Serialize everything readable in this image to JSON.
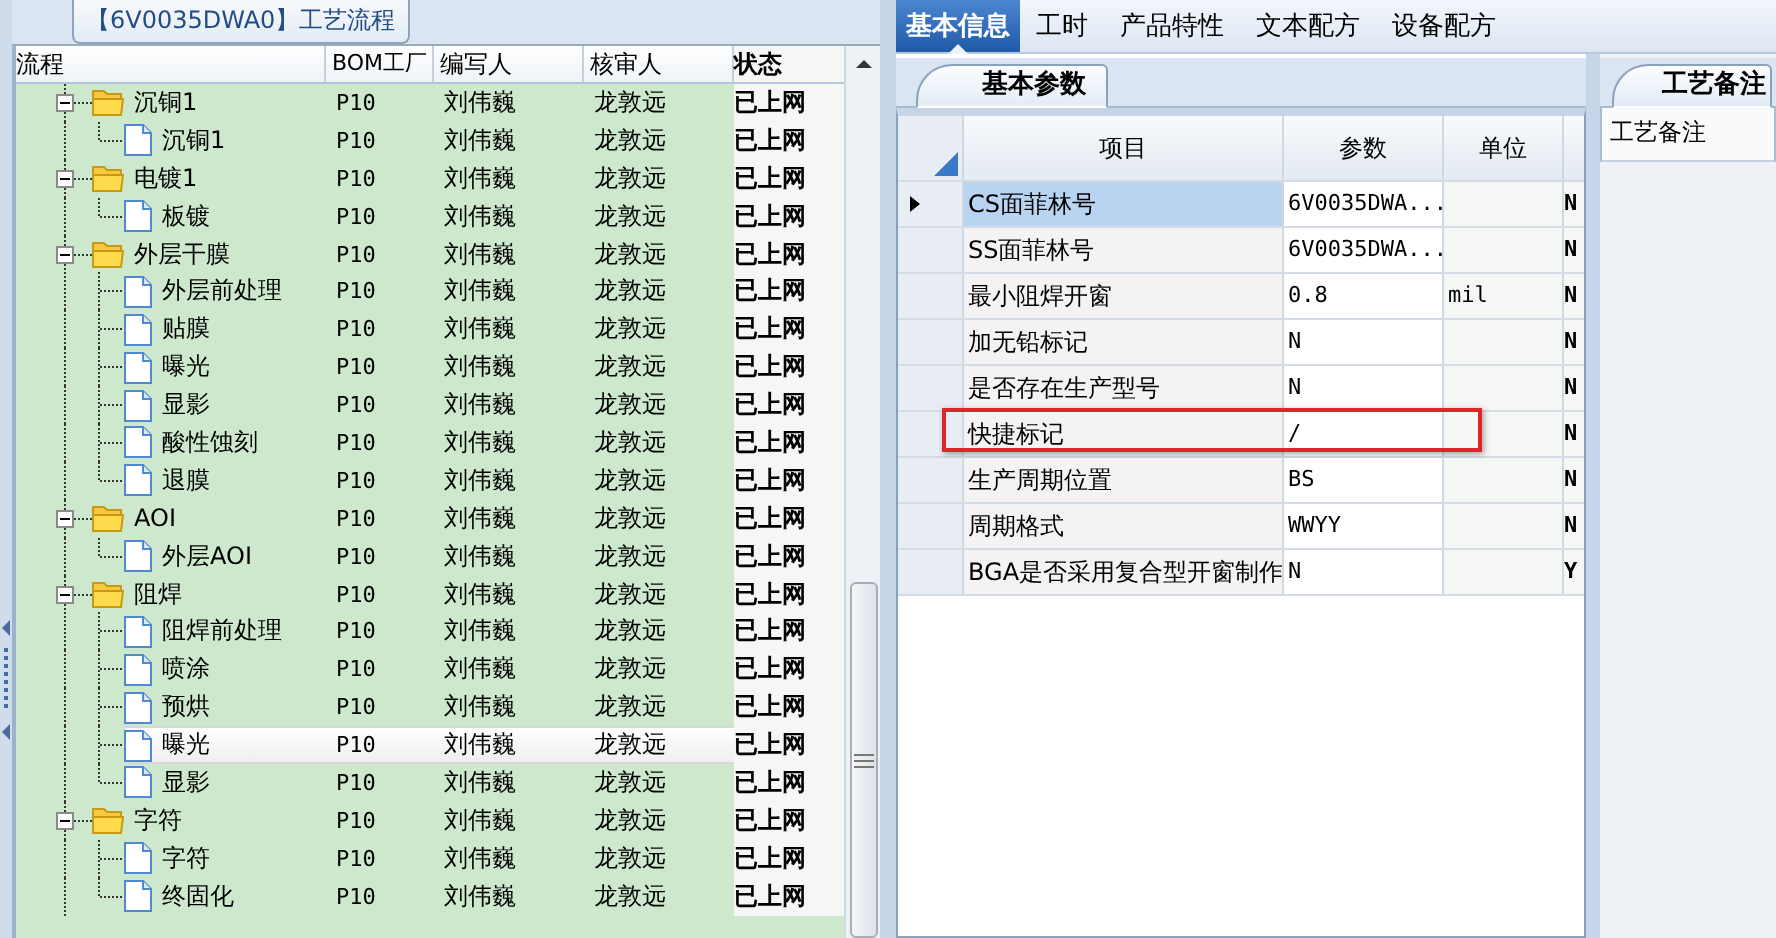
{
  "tree_title": "【6V0035DWA0】工艺流程",
  "tree_table": {
    "columns": [
      "流程",
      "BOM工厂",
      "编写人",
      "核审人",
      "状态"
    ],
    "nodes": [
      {
        "kind": "folder",
        "name": "沉铜1",
        "bom": "P10",
        "author": "刘伟巍",
        "reviewer": "龙敦远",
        "status": "已上网",
        "expanded": true,
        "selected": false,
        "children": [
          {
            "kind": "step",
            "name": "沉铜1",
            "bom": "P10",
            "author": "刘伟巍",
            "reviewer": "龙敦远",
            "status": "已上网",
            "selected": false
          }
        ]
      },
      {
        "kind": "folder",
        "name": "电镀1",
        "bom": "P10",
        "author": "刘伟巍",
        "reviewer": "龙敦远",
        "status": "已上网",
        "expanded": true,
        "selected": false,
        "children": [
          {
            "kind": "step",
            "name": "板镀",
            "bom": "P10",
            "author": "刘伟巍",
            "reviewer": "龙敦远",
            "status": "已上网",
            "selected": false
          }
        ]
      },
      {
        "kind": "folder",
        "name": "外层干膜",
        "bom": "P10",
        "author": "刘伟巍",
        "reviewer": "龙敦远",
        "status": "已上网",
        "expanded": true,
        "selected": false,
        "children": [
          {
            "kind": "step",
            "name": "外层前处理",
            "bom": "P10",
            "author": "刘伟巍",
            "reviewer": "龙敦远",
            "status": "已上网",
            "selected": false
          },
          {
            "kind": "step",
            "name": "贴膜",
            "bom": "P10",
            "author": "刘伟巍",
            "reviewer": "龙敦远",
            "status": "已上网",
            "selected": false
          },
          {
            "kind": "step",
            "name": "曝光",
            "bom": "P10",
            "author": "刘伟巍",
            "reviewer": "龙敦远",
            "status": "已上网",
            "selected": false
          },
          {
            "kind": "step",
            "name": "显影",
            "bom": "P10",
            "author": "刘伟巍",
            "reviewer": "龙敦远",
            "status": "已上网",
            "selected": false
          },
          {
            "kind": "step",
            "name": "酸性蚀刻",
            "bom": "P10",
            "author": "刘伟巍",
            "reviewer": "龙敦远",
            "status": "已上网",
            "selected": false
          },
          {
            "kind": "step",
            "name": "退膜",
            "bom": "P10",
            "author": "刘伟巍",
            "reviewer": "龙敦远",
            "status": "已上网",
            "selected": false
          }
        ]
      },
      {
        "kind": "folder",
        "name": "AOI",
        "bom": "P10",
        "author": "刘伟巍",
        "reviewer": "龙敦远",
        "status": "已上网",
        "expanded": true,
        "selected": false,
        "children": [
          {
            "kind": "step",
            "name": "外层AOI",
            "bom": "P10",
            "author": "刘伟巍",
            "reviewer": "龙敦远",
            "status": "已上网",
            "selected": false
          }
        ]
      },
      {
        "kind": "folder",
        "name": "阻焊",
        "bom": "P10",
        "author": "刘伟巍",
        "reviewer": "龙敦远",
        "status": "已上网",
        "expanded": true,
        "selected": false,
        "children": [
          {
            "kind": "step",
            "name": "阻焊前处理",
            "bom": "P10",
            "author": "刘伟巍",
            "reviewer": "龙敦远",
            "status": "已上网",
            "selected": false
          },
          {
            "kind": "step",
            "name": "喷涂",
            "bom": "P10",
            "author": "刘伟巍",
            "reviewer": "龙敦远",
            "status": "已上网",
            "selected": false
          },
          {
            "kind": "step",
            "name": "预烘",
            "bom": "P10",
            "author": "刘伟巍",
            "reviewer": "龙敦远",
            "status": "已上网",
            "selected": false
          },
          {
            "kind": "step",
            "name": "曝光",
            "bom": "P10",
            "author": "刘伟巍",
            "reviewer": "龙敦远",
            "status": "已上网",
            "selected": true
          },
          {
            "kind": "step",
            "name": "显影",
            "bom": "P10",
            "author": "刘伟巍",
            "reviewer": "龙敦远",
            "status": "已上网",
            "selected": false
          }
        ]
      },
      {
        "kind": "folder",
        "name": "字符",
        "bom": "P10",
        "author": "刘伟巍",
        "reviewer": "龙敦远",
        "status": "已上网",
        "expanded": true,
        "selected": false,
        "children": [
          {
            "kind": "step",
            "name": "字符",
            "bom": "P10",
            "author": "刘伟巍",
            "reviewer": "龙敦远",
            "status": "已上网",
            "selected": false
          },
          {
            "kind": "step",
            "name": "终固化",
            "bom": "P10",
            "author": "刘伟巍",
            "reviewer": "龙敦远",
            "status": "已上网",
            "selected": false
          }
        ]
      }
    ]
  },
  "tabs": [
    {
      "label": "基本信息",
      "selected": true
    },
    {
      "label": "工时",
      "selected": false
    },
    {
      "label": "产品特性",
      "selected": false
    },
    {
      "label": "文本配方",
      "selected": false
    },
    {
      "label": "设备配方",
      "selected": false
    }
  ],
  "params": {
    "title": "基本参数",
    "columns": [
      "项目",
      "参数",
      "单位"
    ],
    "rows": [
      {
        "item": "CS面菲林号",
        "value": "6V0035DWA...",
        "column_4": "N",
        "selected": true,
        "highlighted": false
      },
      {
        "item": "SS面菲林号",
        "value": "6V0035DWA...",
        "column_4": "N",
        "selected": false,
        "highlighted": false
      },
      {
        "item": "最小阻焊开窗",
        "value": "0.8",
        "unit": "mil",
        "column_4": "N",
        "selected": false,
        "highlighted": false
      },
      {
        "item": "加无铅标记",
        "value": "N",
        "column_4": "N",
        "selected": false,
        "highlighted": false
      },
      {
        "item": "是否存在生产型号",
        "value": "N",
        "column_4": "N",
        "selected": false,
        "highlighted": false
      },
      {
        "item": "快捷标记",
        "value": "/",
        "column_4": "N",
        "selected": false,
        "highlighted": true
      },
      {
        "item": "生产周期位置",
        "value": "BS",
        "column_4": "N",
        "selected": false,
        "highlighted": false
      },
      {
        "item": "周期格式",
        "value": "WWYY",
        "column_4": "N",
        "selected": false,
        "highlighted": false
      },
      {
        "item": "BGA是否采用复合型开窗制作",
        "value": "N",
        "column_4": "Y",
        "selected": false,
        "highlighted": false
      }
    ]
  },
  "notes": {
    "title": "工艺备注",
    "label": "工艺备注"
  }
}
